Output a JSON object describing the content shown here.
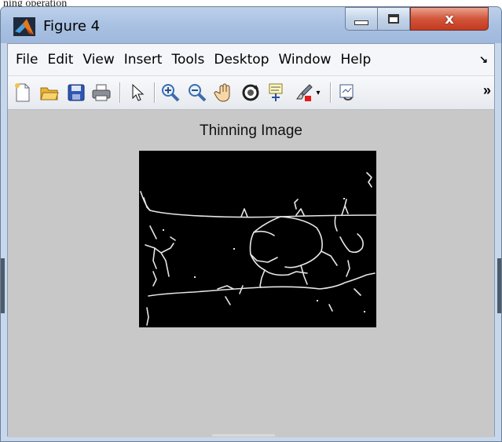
{
  "caption": "ning operation",
  "window": {
    "title": "Figure 4",
    "controls": {
      "minimize": "minimize",
      "maximize": "maximize",
      "close": "x"
    }
  },
  "menu": {
    "items": [
      "File",
      "Edit",
      "View",
      "Insert",
      "Tools",
      "Desktop",
      "Window",
      "Help"
    ],
    "overflow": "↘"
  },
  "toolbar": {
    "buttons": [
      "new-figure",
      "open-file",
      "save-figure",
      "print-figure",
      "edit-plot",
      "zoom-in",
      "zoom-out",
      "pan",
      "rotate-3d",
      "data-cursor",
      "brush",
      "link-plot"
    ],
    "overflow": "»"
  },
  "figure": {
    "title": "Thinning Image"
  },
  "colors": {
    "figure_background": "#c8c8c8",
    "image_background": "#000000",
    "image_lines": "#ffffff",
    "close_button": "#c84a2e"
  }
}
